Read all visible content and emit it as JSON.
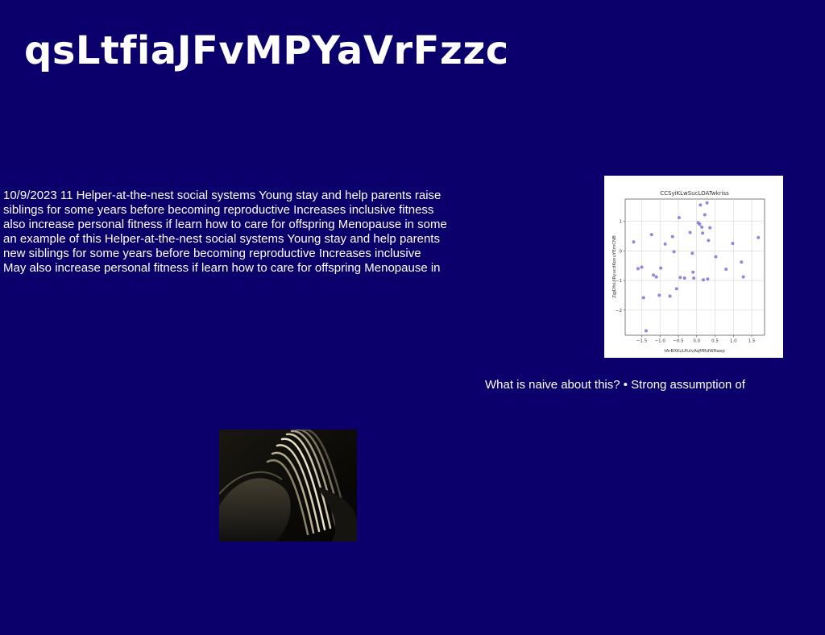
{
  "slide": {
    "title": "qsLtfiaJFvMPYaVrFzzc",
    "body_lines": [
      "10/9/2023 11 Helper-at-the-nest social systems Young stay and help parents raise",
      "siblings for some years before becoming reproductive Increases inclusive fitness",
      "also increase personal fitness if learn how to care for offspring Menopause in some",
      "an example of this Helper-at-the-nest social systems Young stay and help parents",
      "new siblings for some years before becoming reproductive Increases inclusive",
      "May also increase personal fitness if learn how to care for offspring Menopause in"
    ],
    "caption": "What is naive about this? • Strong assumption of"
  },
  "colors": {
    "background": "#0b006b",
    "text": "#ffffff",
    "point": "#7b73d6"
  },
  "chart_data": {
    "type": "scatter",
    "title": "CCSyiKLwSucLOATwkriss",
    "xlabel": "tArBXKuUfulvAqMRdWRaep",
    "ylabel": "ZgjDfsUIRyucdKonuYEmCNB",
    "xlim": [
      -1.95,
      1.85
    ],
    "ylim": [
      -2.85,
      1.75
    ],
    "xticks": [
      -1.5,
      -1.0,
      -0.5,
      0.0,
      0.5,
      1.0,
      1.5
    ],
    "xtick_labels": [
      "−1.5",
      "−1.0",
      "−0.5",
      "0.0",
      "0.5",
      "1.0",
      "1.5"
    ],
    "yticks": [
      -2,
      -1,
      0,
      1
    ],
    "ytick_labels": [
      "−2",
      "−1",
      "0",
      "1"
    ],
    "grid": true,
    "x": [
      -1.72,
      -1.6,
      -1.5,
      -1.45,
      -1.38,
      -1.23,
      -1.18,
      -1.1,
      -1.02,
      -0.98,
      -0.86,
      -0.73,
      -0.66,
      -0.62,
      -0.55,
      -0.48,
      -0.45,
      -0.33,
      -0.18,
      -0.12,
      -0.1,
      -0.08,
      0.04,
      0.08,
      0.1,
      0.14,
      0.16,
      0.18,
      0.22,
      0.28,
      0.3,
      0.32,
      0.36,
      0.52,
      0.8,
      0.98,
      1.22,
      1.27,
      1.68
    ],
    "y": [
      0.3,
      -0.6,
      -0.55,
      -1.58,
      -2.7,
      0.55,
      -0.82,
      -0.88,
      -1.5,
      -0.58,
      0.23,
      -1.53,
      0.48,
      -0.03,
      -1.28,
      1.12,
      -0.9,
      -0.92,
      0.62,
      -0.08,
      -0.72,
      -0.92,
      0.95,
      0.9,
      1.55,
      0.8,
      0.6,
      -0.98,
      1.22,
      1.62,
      -0.95,
      0.35,
      0.78,
      -0.2,
      -0.62,
      0.25,
      -0.38,
      -0.88,
      0.45
    ]
  }
}
